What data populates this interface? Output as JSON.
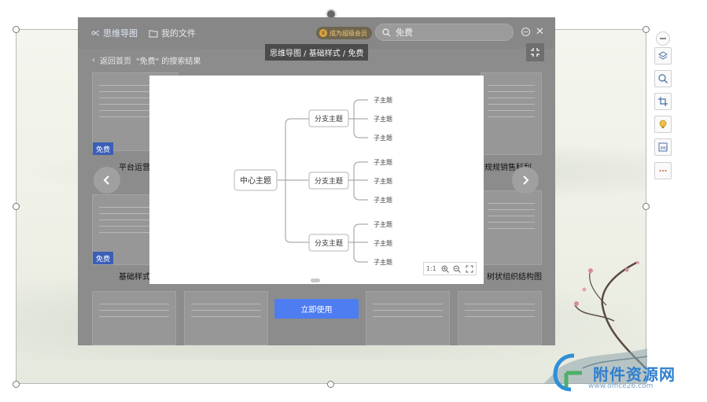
{
  "header": {
    "brand": "思维导图",
    "my_files": "我的文件",
    "vip_label": "成为超级会员",
    "search_value": "免费"
  },
  "nav": {
    "back_label": "返回首页",
    "results_label": "\"免费\" 的搜索结果"
  },
  "breadcrumb": "思维导图 / 基础样式 / 免费",
  "cards": [
    {
      "title": "平台运营",
      "badge": "免费"
    },
    {
      "title": "基础样式",
      "badge": "免费"
    },
    {
      "title": "规规销售科利"
    },
    {
      "title": "树状组织结构图"
    }
  ],
  "use_button": "立即使用",
  "mindmap": {
    "center": "中心主题",
    "branches": [
      {
        "label": "分支主题",
        "children": [
          "子主题",
          "子主题",
          "子主题"
        ]
      },
      {
        "label": "分支主题",
        "children": [
          "子主题",
          "子主题",
          "子主题"
        ]
      },
      {
        "label": "分支主题",
        "children": [
          "子主题",
          "子主题",
          "子主题"
        ]
      }
    ]
  },
  "zoom_controls": [
    "1:1",
    "zoom-in-icon",
    "zoom-out-icon",
    "fullscreen-icon"
  ],
  "watermark": {
    "name": "附件资源网",
    "url": "www.office26.com"
  },
  "colors": {
    "accent": "#4e7df1",
    "badge": "#3b5eb7",
    "brand_text": "#dde6f4"
  }
}
